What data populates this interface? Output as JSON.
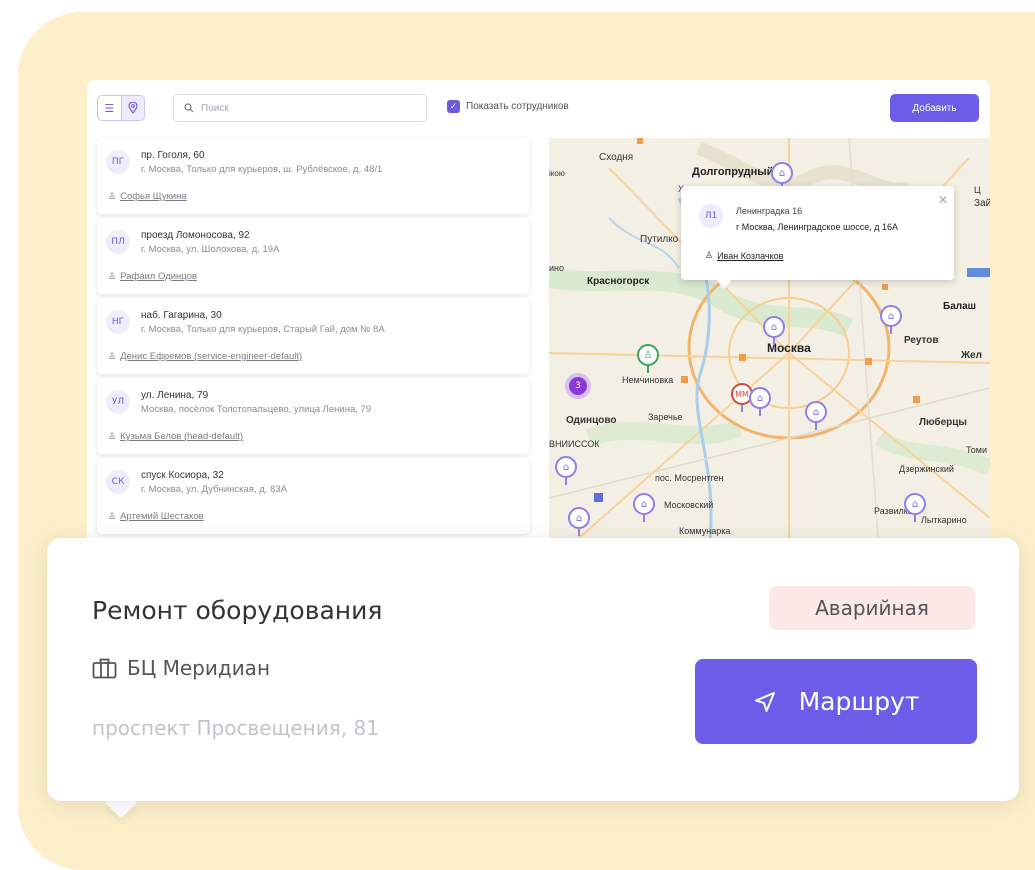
{
  "toolbar": {
    "view_list_icon": "list-icon",
    "view_map_icon": "map-pin-icon",
    "search_placeholder": "Поиск",
    "show_employees_label": "Показать сотрудников",
    "show_employees_checked": true,
    "add_button_label": "Добавить"
  },
  "list": [
    {
      "initials": "ПГ",
      "title": "пр. Гоголя, 60",
      "address": "г. Москва, Только для курьеров, ш. Рублёвское, д. 48/1",
      "employee": "Софья Щукина"
    },
    {
      "initials": "ПЛ",
      "title": "проезд Ломоносова, 92",
      "address": "г. Москва, ул. Шолохова, д. 19А",
      "employee": "Рафаил Одинцов"
    },
    {
      "initials": "НГ",
      "title": "наб. Гагарина, 30",
      "address": "г. Москва, Только для курьеров, Старый Гай, дом № 8А",
      "employee": "Денис Ефремов (service-engineer-default)"
    },
    {
      "initials": "УЛ",
      "title": "ул. Ленина, 79",
      "address": "Москва, посёлок Толстопальцево, улица Ленина, 79",
      "employee": "Кузьма Белов (head-default)"
    },
    {
      "initials": "СК",
      "title": "спуск Косиора, 32",
      "address": "г. Москва, ул. Дубнинская, д. 83А",
      "employee": "Артемий Шестаков"
    }
  ],
  "map": {
    "labels": {
      "skhodnya": "Сходня",
      "dolgoprudny": "Долгопрудный",
      "putilkovo": "Путилко",
      "krasnogorsk": "Красногорск",
      "moskva": "Москва",
      "reutov": "Реутов",
      "balash": "Балаш",
      "zhel": "Жел",
      "nemchinovka": "Немчиновка",
      "odintsovo": "Одинцово",
      "zarechye": "Заречье",
      "lyubertsy": "Люберцы",
      "tomi": "Томи",
      "dzerzhinsky": "Дзержинский",
      "vniissok": "ВНИИССОК",
      "mosrentgen": "пос. Мосрентген",
      "moskovsky": "Московский",
      "kommunarka": "Коммунарка",
      "razvilka": "Развилка",
      "lytkarino": "Лыткарино",
      "ikovo": "ікою",
      "ino": "ино",
      "zai": "Зай",
      "metro": "ММ",
      "small_x": "Х",
      "small_l": "Ц"
    },
    "cluster_count": "3",
    "popup": {
      "initials": "Л1",
      "title": "Ленинградка 16",
      "address": "г Москва, Ленинградское шоссе, д 16А",
      "employee": "Иван Козлачков"
    }
  },
  "card": {
    "title": "Ремонт оборудования",
    "building": "БЦ Меридиан",
    "address": "проспект Просвещения, 81",
    "priority": "Аварийная",
    "route_button": "Маршрут"
  },
  "colors": {
    "accent": "#6c5ce7",
    "background": "#fcefc9",
    "badge_bg": "#fbe8e7",
    "pin": "#8f7fe8",
    "pin_green": "#3aa55c",
    "cluster": "#8a39d6"
  }
}
